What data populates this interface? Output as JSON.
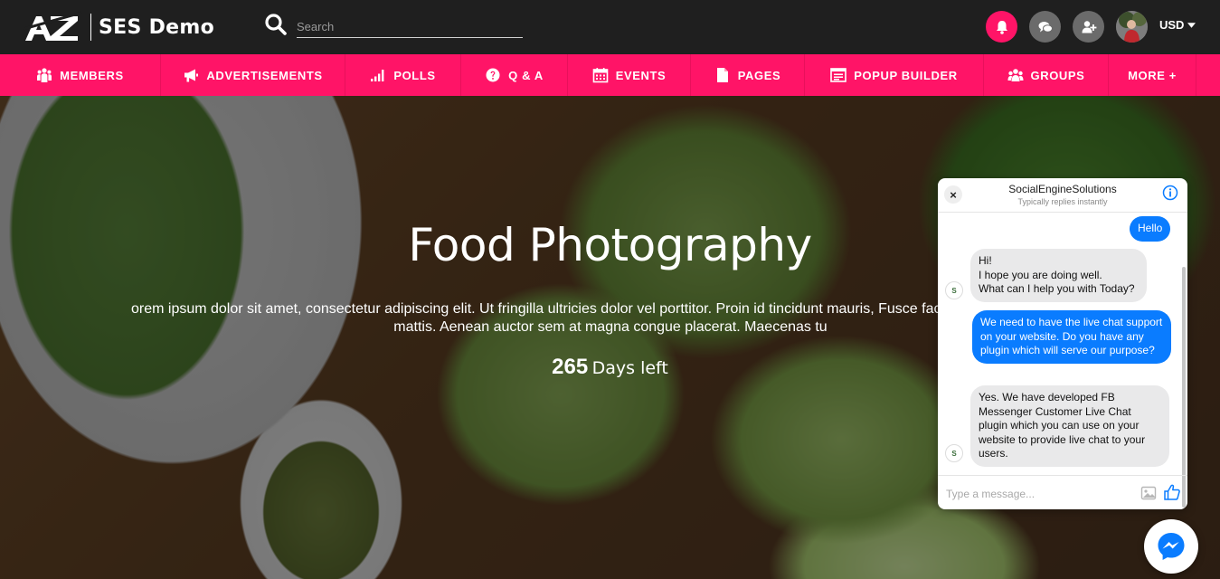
{
  "header": {
    "logo_mark": "AZ",
    "site_name": "SES Demo",
    "search_placeholder": "Search",
    "currency": "USD",
    "icons": [
      "bell-icon",
      "chat-icon",
      "add-user-icon"
    ],
    "colors": {
      "bar": "#1f1f1f",
      "notification": "#ff1467",
      "icon_button": "#6b6b6b"
    }
  },
  "nav": {
    "accent": "#ff1467",
    "items": [
      {
        "label": "MEMBERS",
        "icon": "members-icon"
      },
      {
        "label": "ADVERTISEMENTS",
        "icon": "megaphone-icon"
      },
      {
        "label": "POLLS",
        "icon": "signal-bars-icon"
      },
      {
        "label": "Q & A",
        "icon": "question-icon"
      },
      {
        "label": "EVENTS",
        "icon": "calendar-icon"
      },
      {
        "label": "PAGES",
        "icon": "page-icon"
      },
      {
        "label": "POPUP BUILDER",
        "icon": "popup-window-icon"
      },
      {
        "label": "GROUPS",
        "icon": "groups-icon"
      },
      {
        "label": "MORE +",
        "icon": ""
      }
    ]
  },
  "hero": {
    "title": "Food Photography",
    "description": "orem ipsum dolor sit amet, consectetur adipiscing elit. Ut fringilla ultricies dolor vel porttitor. Proin id tincidunt mauris, Fusce facilisis vehicula ante eget mattis. Aenean auctor sem at magna congue placerat. Maecenas tu",
    "days_count": "265",
    "days_label": "Days left"
  },
  "chat": {
    "page_name": "SocialEngineSolutions",
    "subtitle": "Typically replies instantly",
    "close_label": "×",
    "input_placeholder": "Type a message...",
    "avatar_letter": "S",
    "accent": "#0a7cff",
    "messages": [
      {
        "from": "user",
        "text": "Hello"
      },
      {
        "from": "page",
        "text": "Hi!\nI hope you are doing well.\nWhat can I help you with Today?"
      },
      {
        "from": "user",
        "text": "We need to have the live chat support on your website. Do you have any plugin which will serve our purpose?"
      },
      {
        "from": "page",
        "text": "Yes. We have developed FB Messenger Customer Live Chat plugin which you can use on your website to provide live chat to your users."
      }
    ]
  }
}
